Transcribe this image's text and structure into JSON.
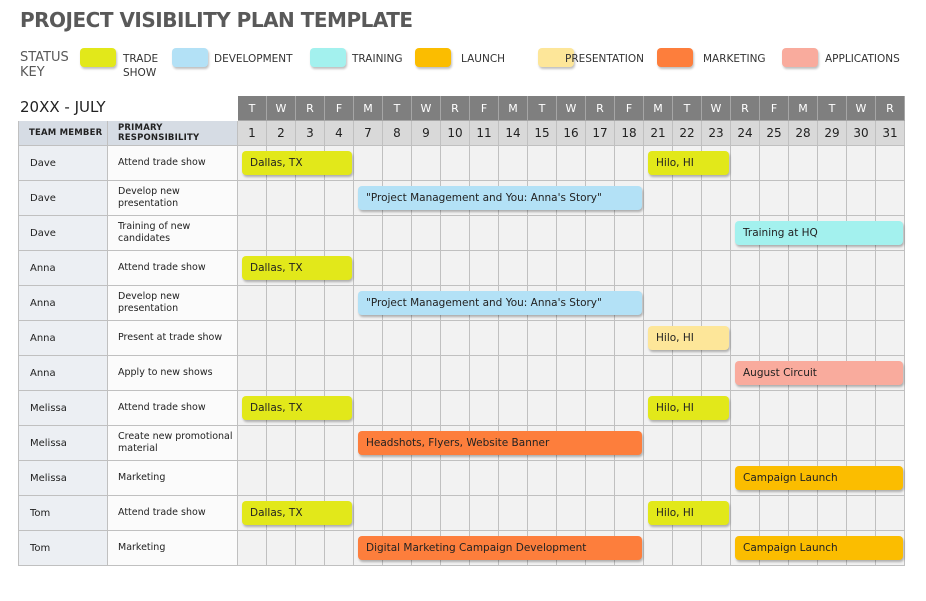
{
  "title": "PROJECT VISIBILITY PLAN TEMPLATE",
  "status_key": {
    "label": "STATUS KEY",
    "items": [
      {
        "label": "TRADE SHOW",
        "color": "#e2e81a"
      },
      {
        "label": "DEVELOPMENT",
        "color": "#b3e1f6"
      },
      {
        "label": "TRAINING",
        "color": "#a3f1ee"
      },
      {
        "label": "LAUNCH",
        "color": "#fbbd00"
      },
      {
        "label": "PRESENTATION",
        "color": "#fde699"
      },
      {
        "label": "MARKETING",
        "color": "#fd7e3c"
      },
      {
        "label": "APPLICATIONS",
        "color": "#f9ab9d"
      }
    ]
  },
  "month": "20XX - JULY",
  "headers": {
    "member": "TEAM MEMBER",
    "responsibility": "PRIMARY RESPONSIBILITY"
  },
  "days": [
    [
      "T",
      "1"
    ],
    [
      "W",
      "2"
    ],
    [
      "R",
      "3"
    ],
    [
      "F",
      "4"
    ],
    [
      "M",
      "7"
    ],
    [
      "T",
      "8"
    ],
    [
      "W",
      "9"
    ],
    [
      "R",
      "10"
    ],
    [
      "F",
      "11"
    ],
    [
      "M",
      "14"
    ],
    [
      "T",
      "15"
    ],
    [
      "W",
      "16"
    ],
    [
      "R",
      "17"
    ],
    [
      "F",
      "18"
    ],
    [
      "M",
      "21"
    ],
    [
      "T",
      "22"
    ],
    [
      "W",
      "23"
    ],
    [
      "R",
      "24"
    ],
    [
      "F",
      "25"
    ],
    [
      "M",
      "28"
    ],
    [
      "T",
      "29"
    ],
    [
      "W",
      "30"
    ],
    [
      "R",
      "31"
    ]
  ],
  "rows": [
    {
      "member": "Dave",
      "responsibility": "Attend trade show",
      "tasks": [
        {
          "label": "Dallas, TX",
          "start": "1",
          "end": "4",
          "status": 0
        },
        {
          "label": "Hilo, HI",
          "start": "21",
          "end": "23",
          "status": 0
        }
      ]
    },
    {
      "member": "Dave",
      "responsibility": "Develop new presentation",
      "tasks": [
        {
          "label": "\"Project Management and You: Anna's Story\"",
          "start": "7",
          "end": "18",
          "status": 1
        }
      ]
    },
    {
      "member": "Dave",
      "responsibility": "Training of new candidates",
      "tasks": [
        {
          "label": "Training at HQ",
          "start": "24",
          "end": "31",
          "status": 2
        }
      ]
    },
    {
      "member": "Anna",
      "responsibility": "Attend trade show",
      "tasks": [
        {
          "label": "Dallas, TX",
          "start": "1",
          "end": "4",
          "status": 0
        }
      ]
    },
    {
      "member": "Anna",
      "responsibility": "Develop new presentation",
      "tasks": [
        {
          "label": "\"Project Management and You: Anna's Story\"",
          "start": "7",
          "end": "18",
          "status": 1
        }
      ]
    },
    {
      "member": "Anna",
      "responsibility": "Present at trade show",
      "tasks": [
        {
          "label": "Hilo, HI",
          "start": "21",
          "end": "23",
          "status": 4
        }
      ]
    },
    {
      "member": "Anna",
      "responsibility": "Apply to new shows",
      "tasks": [
        {
          "label": "August Circuit",
          "start": "24",
          "end": "31",
          "status": 6
        }
      ]
    },
    {
      "member": "Melissa",
      "responsibility": "Attend trade show",
      "tasks": [
        {
          "label": "Dallas, TX",
          "start": "1",
          "end": "4",
          "status": 0
        },
        {
          "label": "Hilo, HI",
          "start": "21",
          "end": "23",
          "status": 0
        }
      ]
    },
    {
      "member": "Melissa",
      "responsibility": "Create new promotional material",
      "tasks": [
        {
          "label": "Headshots, Flyers, Website Banner",
          "start": "7",
          "end": "18",
          "status": 5
        }
      ]
    },
    {
      "member": "Melissa",
      "responsibility": "Marketing",
      "tasks": [
        {
          "label": "Campaign Launch",
          "start": "24",
          "end": "31",
          "status": 3
        }
      ]
    },
    {
      "member": "Tom",
      "responsibility": "Attend trade show",
      "tasks": [
        {
          "label": "Dallas, TX",
          "start": "1",
          "end": "4",
          "status": 0
        },
        {
          "label": "Hilo, HI",
          "start": "21",
          "end": "23",
          "status": 0
        }
      ]
    },
    {
      "member": "Tom",
      "responsibility": "Marketing",
      "tasks": [
        {
          "label": "Digital Marketing Campaign Development",
          "start": "7",
          "end": "18",
          "status": 5
        },
        {
          "label": "Campaign Launch",
          "start": "24",
          "end": "31",
          "status": 3
        }
      ]
    }
  ]
}
